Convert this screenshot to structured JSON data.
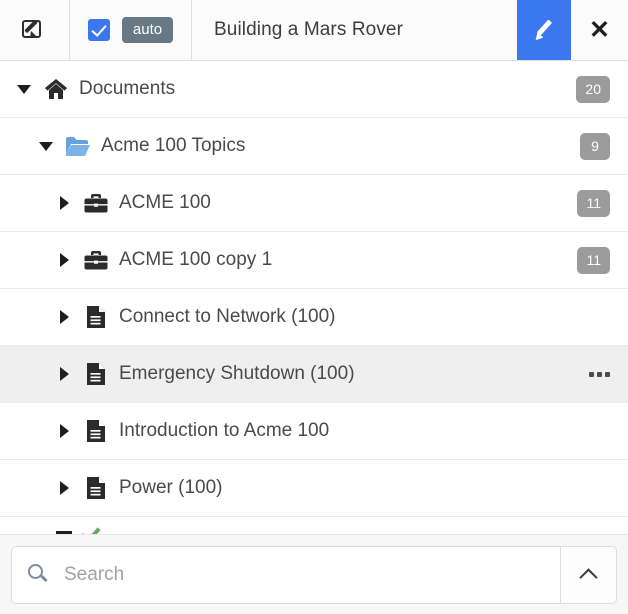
{
  "header": {
    "compose_icon": "compose-icon",
    "checkbox_checked": true,
    "auto_label": "auto",
    "title": "Building a Mars Rover",
    "edit_icon": "pencil-icon",
    "close_icon": "close-icon",
    "accent_color": "#3b78f0",
    "auto_badge_color": "#687884"
  },
  "tree": {
    "badge_color": "#9b9b9b",
    "selected_row_color": "#efefef",
    "items": [
      {
        "label": "Documents",
        "icon": "home-icon",
        "twisty": "caret-down",
        "badge": "20",
        "indent": 0,
        "selected": false,
        "has_more_menu": false
      },
      {
        "label": "Acme 100 Topics",
        "icon": "folder-open-icon",
        "twisty": "caret-down",
        "badge": "9",
        "indent": 1,
        "selected": false,
        "has_more_menu": false
      },
      {
        "label": "ACME 100",
        "icon": "briefcase-icon",
        "twisty": "caret-right",
        "badge": "11",
        "indent": 2,
        "selected": false,
        "has_more_menu": false
      },
      {
        "label": "ACME 100 copy 1",
        "icon": "briefcase-icon",
        "twisty": "caret-right",
        "badge": "11",
        "indent": 2,
        "selected": false,
        "has_more_menu": false
      },
      {
        "label": "Connect to Network (100)",
        "icon": "document-icon",
        "twisty": "caret-right",
        "badge": "",
        "indent": 2,
        "selected": false,
        "has_more_menu": false
      },
      {
        "label": "Emergency Shutdown (100)",
        "icon": "document-icon",
        "twisty": "caret-right",
        "badge": "",
        "indent": 2,
        "selected": true,
        "has_more_menu": true
      },
      {
        "label": "Introduction to Acme 100",
        "icon": "document-icon",
        "twisty": "caret-right",
        "badge": "",
        "indent": 2,
        "selected": false,
        "has_more_menu": false
      },
      {
        "label": "Power (100)",
        "icon": "document-icon",
        "twisty": "caret-right",
        "badge": "",
        "indent": 2,
        "selected": false,
        "has_more_menu": false
      }
    ],
    "partial_row": {
      "label": "",
      "icon": "check-icon",
      "twisty": "dash",
      "check_color": "#62ab5a"
    }
  },
  "footer": {
    "search_icon": "search-icon",
    "search_value": "",
    "search_placeholder": "Search",
    "collapse_icon": "chevron-up-icon"
  }
}
